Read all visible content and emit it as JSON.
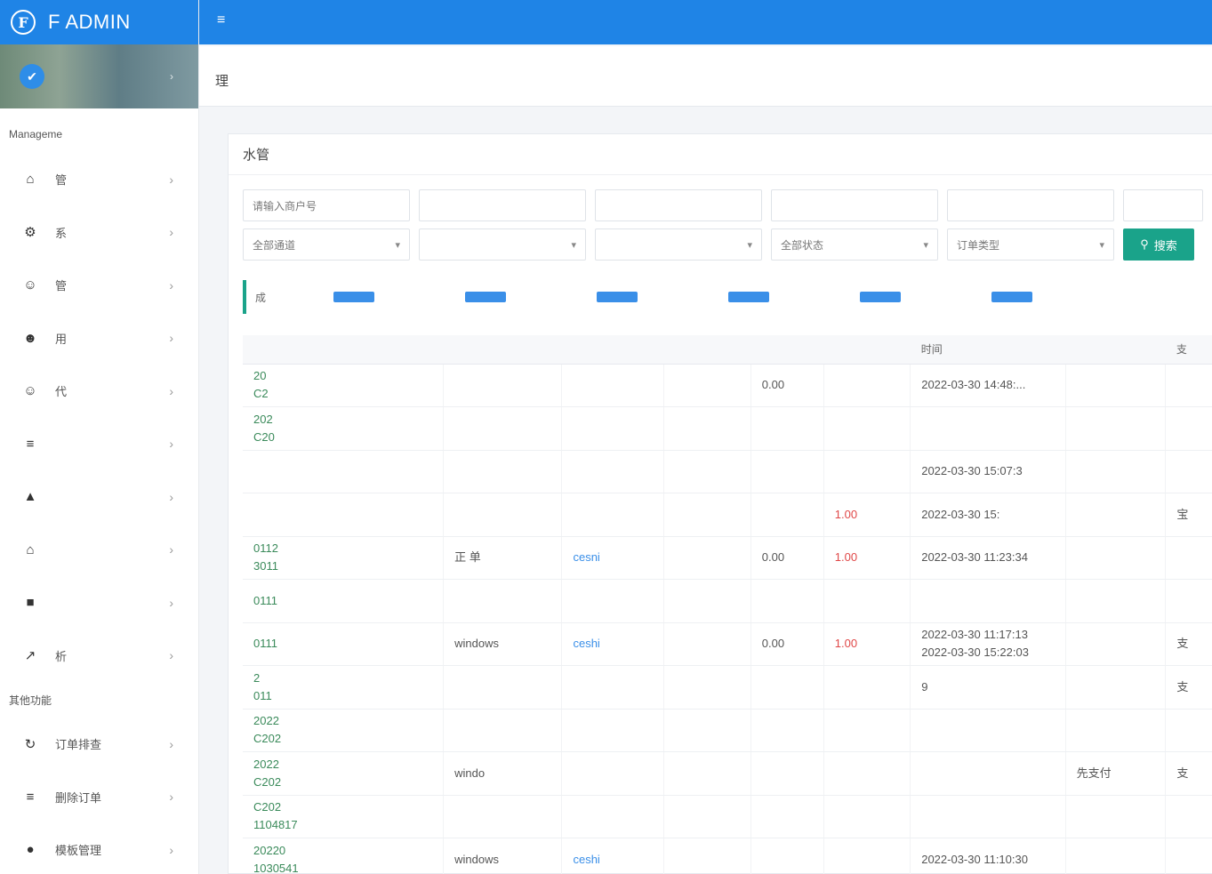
{
  "brand": {
    "logo_letter": "F",
    "title": "F    ADMIN"
  },
  "user_panel": {
    "name": ""
  },
  "sidebar": {
    "section_label": "Manageme",
    "items": [
      {
        "icon": "home-icon",
        "glyph": "⌂",
        "label": "管"
      },
      {
        "icon": "gears-icon",
        "glyph": "⚙",
        "label": "系"
      },
      {
        "icon": "user-circle-icon",
        "glyph": "☺",
        "label": "管"
      },
      {
        "icon": "users-icon",
        "glyph": "☻",
        "label": "用"
      },
      {
        "icon": "user-circle-icon",
        "glyph": "☺",
        "label": "代"
      },
      {
        "icon": "list-icon",
        "glyph": "≡",
        "label": ""
      },
      {
        "icon": "bag-icon",
        "glyph": "▲",
        "label": ""
      },
      {
        "icon": "bank-icon",
        "glyph": "⌂",
        "label": ""
      },
      {
        "icon": "book-icon",
        "glyph": "■",
        "label": ""
      },
      {
        "icon": "chart-line-icon",
        "glyph": "↗",
        "label": "析"
      }
    ],
    "other_label": "其他功能",
    "other_items": [
      {
        "icon": "refresh-icon",
        "glyph": "↻",
        "label": "订单排查"
      },
      {
        "icon": "list-icon",
        "glyph": "≡",
        "label": "删除订单"
      },
      {
        "icon": "apple-icon",
        "glyph": "●",
        "label": "模板管理"
      }
    ]
  },
  "page": {
    "title": "理"
  },
  "panel": {
    "title": "水管"
  },
  "filters": {
    "merchant_placeholder": "请输入商户号",
    "channel": "全部通道",
    "status": "全部状态",
    "order_type": "订单类型",
    "search_label": "搜索"
  },
  "stats": [
    {
      "label": "成",
      "value": ""
    },
    {
      "label": "",
      "value": ""
    },
    {
      "label": "",
      "value": ""
    },
    {
      "label": "",
      "value": ""
    },
    {
      "label": "",
      "value": ""
    },
    {
      "label": "",
      "value": ""
    }
  ],
  "table": {
    "headers": [
      "",
      "",
      "",
      "",
      "",
      "",
      "时间",
      "",
      "支"
    ],
    "rows": [
      {
        "order": [
          "20",
          "C2"
        ],
        "client": "",
        "user": "",
        "amount": "0.00",
        "fee": "",
        "time": [
          "",
          "2022-03-30 14:48:..."
        ],
        "channel": "",
        "pay": ""
      },
      {
        "order": [
          "202",
          "C20"
        ],
        "client": "",
        "user": "",
        "amount": "",
        "fee": "",
        "time": [
          "",
          ""
        ],
        "channel": "",
        "pay": ""
      },
      {
        "order": [
          "",
          ""
        ],
        "client": "",
        "user": "",
        "amount": "",
        "fee": "",
        "time": [
          "2022-03-30 15:07:3",
          ""
        ],
        "channel": "",
        "pay": ""
      },
      {
        "order": [
          "",
          ""
        ],
        "client": "",
        "user": "",
        "amount": "",
        "fee": "1.00",
        "time": [
          "",
          "2022-03-30 15:"
        ],
        "channel": "",
        "pay": "宝"
      },
      {
        "order": [
          "0112",
          "3011"
        ],
        "client": "正 单",
        "user": "cesni",
        "amount": "0.00",
        "fee": "1.00",
        "time": [
          "2022-03-30 11:23:34",
          ""
        ],
        "channel": "",
        "pay": ""
      },
      {
        "order": [
          "0111",
          ""
        ],
        "client": "",
        "user": "",
        "amount": "",
        "fee": "",
        "time": [
          "",
          ""
        ],
        "channel": "",
        "pay": ""
      },
      {
        "order": [
          "0111",
          ""
        ],
        "client": "windows",
        "user": "ceshi",
        "amount": "0.00",
        "fee": "1.00",
        "time": [
          "2022-03-30 11:17:13",
          "2022-03-30 15:22:03"
        ],
        "channel": "",
        "pay": "支"
      },
      {
        "order": [
          "2",
          "011"
        ],
        "client": "",
        "user": "",
        "amount": "",
        "fee": "",
        "time": [
          "",
          "9"
        ],
        "channel": "",
        "pay": "支"
      },
      {
        "order": [
          "2022",
          "C202"
        ],
        "client": "",
        "user": "",
        "amount": "",
        "fee": "",
        "time": [
          "",
          ""
        ],
        "channel": "",
        "pay": ""
      },
      {
        "order": [
          "2022",
          "C202"
        ],
        "client": "windo",
        "user": "",
        "amount": "",
        "fee": "",
        "time": [
          "",
          ""
        ],
        "channel": "先支付",
        "pay": "支"
      },
      {
        "order": [
          "C202",
          "1104817"
        ],
        "client": "",
        "user": "",
        "amount": "",
        "fee": "",
        "time": [
          "",
          ""
        ],
        "channel": "",
        "pay": ""
      },
      {
        "order": [
          "20220",
          "1030541"
        ],
        "client": "windows",
        "user": "ceshi",
        "amount": "",
        "fee": "",
        "time": [
          "2022-03-30 11:10:30",
          ""
        ],
        "channel": "",
        "pay": ""
      }
    ]
  },
  "colors": {
    "primary": "#1f84e6",
    "success": "#1aa38a",
    "danger": "#e04848",
    "link": "#3a8fe8"
  }
}
